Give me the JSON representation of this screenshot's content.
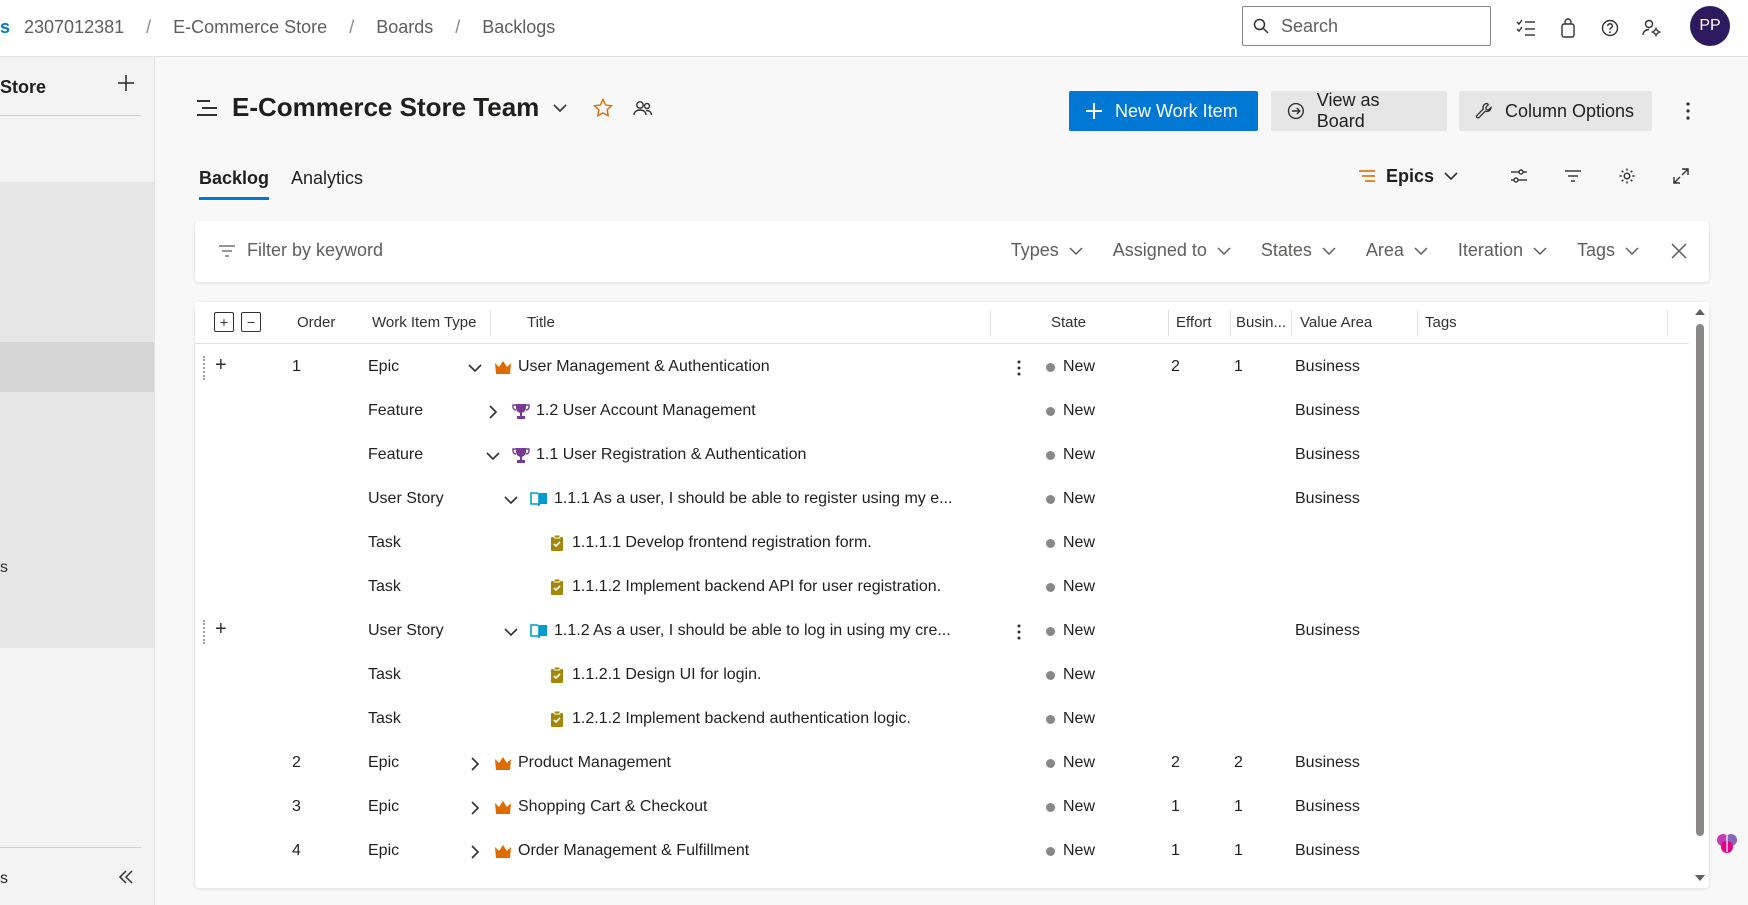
{
  "breadcrumb": {
    "org": "s",
    "project_id": "2307012381",
    "project": "E-Commerce Store",
    "boards": "Boards",
    "backlogs": "Backlogs"
  },
  "search": {
    "placeholder": "Search"
  },
  "user": {
    "initials": "PP"
  },
  "sidebar": {
    "title": "Store",
    "stub_item": "s",
    "footer_stub": "s"
  },
  "header": {
    "team_name": "E-Commerce Store Team",
    "new_work_item": "New Work Item",
    "view_as_board": "View as Board",
    "column_options": "Column Options"
  },
  "tabs": {
    "backlog": "Backlog",
    "analytics": "Analytics"
  },
  "backlog_level": "Epics",
  "filter": {
    "keyword_placeholder": "Filter by keyword",
    "types": "Types",
    "assigned_to": "Assigned to",
    "states": "States",
    "area": "Area",
    "iteration": "Iteration",
    "tags": "Tags"
  },
  "columns": {
    "order": "Order",
    "work_item_type": "Work Item Type",
    "title": "Title",
    "state": "State",
    "effort": "Effort",
    "business": "Busin...",
    "value_area": "Value Area",
    "tags": "Tags"
  },
  "rows": [
    {
      "order": "1",
      "type": "Epic",
      "title": "User Management & Authentication",
      "state": "New",
      "effort": "2",
      "business": "1",
      "value_area": "Business"
    },
    {
      "order": "",
      "type": "Feature",
      "title": "1.2 User Account Management",
      "state": "New",
      "effort": "",
      "business": "",
      "value_area": "Business"
    },
    {
      "order": "",
      "type": "Feature",
      "title": "1.1 User Registration & Authentication",
      "state": "New",
      "effort": "",
      "business": "",
      "value_area": "Business"
    },
    {
      "order": "",
      "type": "User Story",
      "title": "1.1.1 As a user, I should be able to register using my e...",
      "state": "New",
      "effort": "",
      "business": "",
      "value_area": "Business"
    },
    {
      "order": "",
      "type": "Task",
      "title": "1.1.1.1 Develop frontend registration form.",
      "state": "New",
      "effort": "",
      "business": "",
      "value_area": ""
    },
    {
      "order": "",
      "type": "Task",
      "title": "1.1.1.2 Implement backend API for user registration.",
      "state": "New",
      "effort": "",
      "business": "",
      "value_area": ""
    },
    {
      "order": "",
      "type": "User Story",
      "title": "1.1.2 As a user, I should be able to log in using my cre...",
      "state": "New",
      "effort": "",
      "business": "",
      "value_area": "Business"
    },
    {
      "order": "",
      "type": "Task",
      "title": "1.1.2.1 Design UI for login.",
      "state": "New",
      "effort": "",
      "business": "",
      "value_area": ""
    },
    {
      "order": "",
      "type": "Task",
      "title": "1.2.1.2 Implement backend authentication logic.",
      "state": "New",
      "effort": "",
      "business": "",
      "value_area": ""
    },
    {
      "order": "2",
      "type": "Epic",
      "title": "Product Management",
      "state": "New",
      "effort": "2",
      "business": "2",
      "value_area": "Business"
    },
    {
      "order": "3",
      "type": "Epic",
      "title": "Shopping Cart & Checkout",
      "state": "New",
      "effort": "1",
      "business": "1",
      "value_area": "Business"
    },
    {
      "order": "4",
      "type": "Epic",
      "title": "Order Management & Fulfillment",
      "state": "New",
      "effort": "1",
      "business": "1",
      "value_area": "Business"
    }
  ],
  "colors": {
    "accent": "#0078d4",
    "epic": "#e06c00",
    "feature": "#773b93",
    "user_story": "#009ccc",
    "task": "#a4880a",
    "state_new": "#8a8886"
  }
}
